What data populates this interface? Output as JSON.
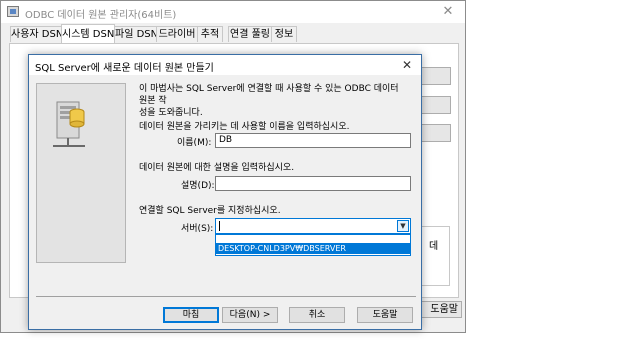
{
  "parent_window": {
    "title": "ODBC 데이터 원본 관리자(64비트)",
    "tabs": [
      {
        "label": "사용자 DSN"
      },
      {
        "label": "시스템 DSN"
      },
      {
        "label": "파일 DSN"
      },
      {
        "label": "드라이버"
      },
      {
        "label": "추적"
      },
      {
        "label": "연결 풀링"
      },
      {
        "label": "정보"
      }
    ],
    "active_tab": "시스템 DSN",
    "fragment_text": "데",
    "help_label": "도움말"
  },
  "dialog": {
    "title": "SQL Server에 새로운 데이터 원본 만들기",
    "intro_line1": "이 마법사는 SQL Server에 연결할 때 사용할 수 있는 ODBC 데이터 원본 작",
    "intro_line2": "성을 도와줍니다.",
    "intro_line3": "데이터 원본을 가리키는 데 사용할 이름을 입력하십시오.",
    "name_label": "이름(M):",
    "name_value": "DB",
    "description_prompt": "데이터 원본에 대한 설명을 입력하십시오.",
    "description_label": "설명(D):",
    "description_value": "",
    "server_prompt": "연결할 SQL Server를 지정하십시오.",
    "server_label": "서버(S):",
    "server_value": "",
    "server_options": [
      "DESKTOP-CNLD3PV₩DBSERVER"
    ],
    "buttons": {
      "finish": "마침",
      "next": "다음(N) >",
      "cancel": "취소",
      "help": "도움말"
    }
  },
  "colors": {
    "accent": "#0078d7",
    "window_bg": "#f0f0f0",
    "border_blue": "#3a6ea5"
  }
}
